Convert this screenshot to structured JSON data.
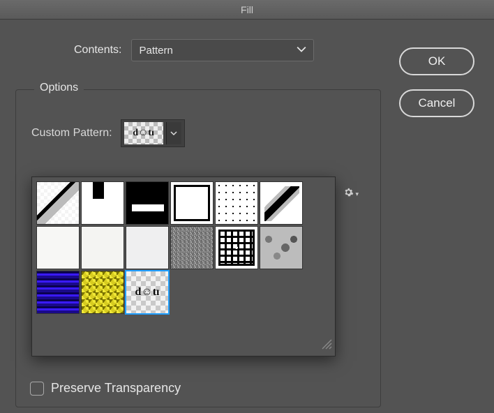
{
  "title": "Fill",
  "contents": {
    "label": "Contents:",
    "value": "Pattern"
  },
  "buttons": {
    "ok": "OK",
    "cancel": "Cancel"
  },
  "options": {
    "legend": "Options",
    "custom_pattern_label": "Custom Pattern:",
    "selected_swatch_text": "d☺tı",
    "selected_index": 14,
    "patterns": [
      {
        "id": "diagonal-stroke"
      },
      {
        "id": "vertical-black-bar"
      },
      {
        "id": "horizontal-white-bar"
      },
      {
        "id": "black-square-outline"
      },
      {
        "id": "polka-dots"
      },
      {
        "id": "diagonal-gray"
      },
      {
        "id": "paper-1"
      },
      {
        "id": "paper-2"
      },
      {
        "id": "paper-3"
      },
      {
        "id": "noise"
      },
      {
        "id": "concentric-squares"
      },
      {
        "id": "gray-organic"
      },
      {
        "id": "blue-water"
      },
      {
        "id": "yellow-grunge"
      },
      {
        "id": "doti-checker"
      }
    ]
  },
  "preserve_transparency_label": "Preserve Transparency",
  "preserve_transparency_checked": false
}
